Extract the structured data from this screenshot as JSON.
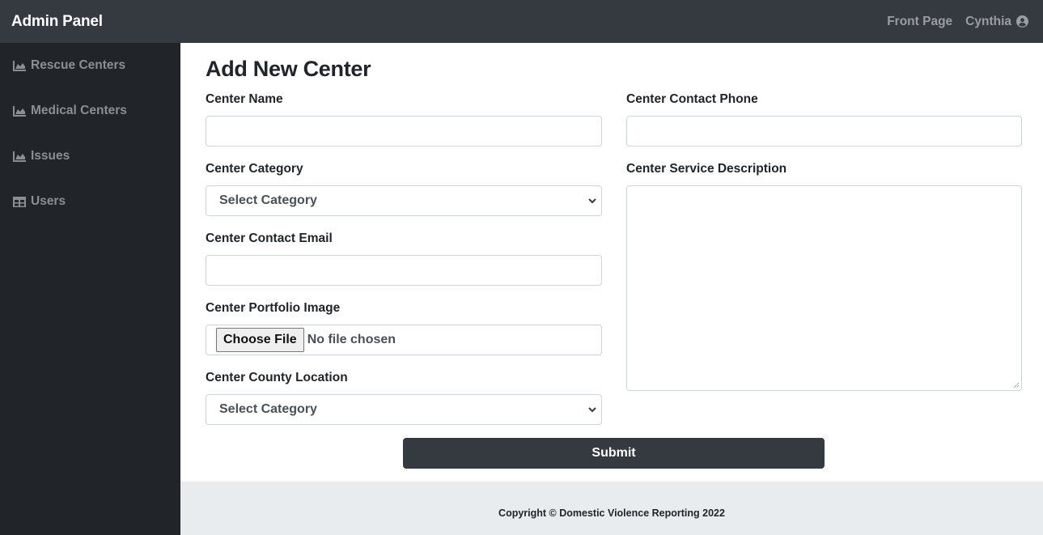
{
  "topbar": {
    "brand": "Admin Panel",
    "links": [
      {
        "label": "Front Page",
        "icon": "none"
      },
      {
        "label": "Cynthia",
        "icon": "user-circle-icon"
      }
    ]
  },
  "sidebar": {
    "items": [
      {
        "label": "Rescue Centers",
        "icon": "area-chart-icon"
      },
      {
        "label": "Medical Centers",
        "icon": "area-chart-icon"
      },
      {
        "label": "Issues",
        "icon": "area-chart-icon"
      },
      {
        "label": "Users",
        "icon": "table-icon"
      }
    ]
  },
  "form": {
    "title": "Add New Center",
    "center_name": {
      "label": "Center Name",
      "value": "",
      "placeholder": ""
    },
    "center_category": {
      "label": "Center Category",
      "selected": "Select Category"
    },
    "center_contact_email": {
      "label": "Center Contact Email",
      "value": "",
      "placeholder": ""
    },
    "center_portfolio_image": {
      "label": "Center Portfolio Image",
      "button_label": "Choose File",
      "status": "No file chosen"
    },
    "center_county_location": {
      "label": "Center County Location",
      "selected": "Select Category"
    },
    "center_contact_phone": {
      "label": "Center Contact Phone",
      "value": "",
      "placeholder": ""
    },
    "center_service_description": {
      "label": "Center Service Description",
      "value": ""
    },
    "submit_label": "Submit"
  },
  "footer": {
    "text": "Copyright © Domestic Violence Reporting 2022"
  },
  "colors": {
    "topbar_bg": "#343a40",
    "sidebar_bg": "#212529",
    "footer_bg": "#e9ecef",
    "button_bg": "#343a40"
  }
}
